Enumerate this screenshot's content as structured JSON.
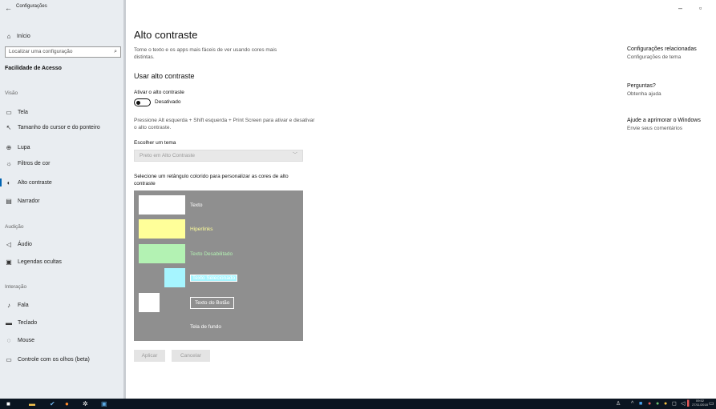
{
  "window": {
    "app_title": "Configurações",
    "back_icon": "arrow-left-icon",
    "controls": {
      "minimize": "–",
      "maximize": "▫"
    }
  },
  "sidebar": {
    "home": {
      "label": "Início",
      "icon": "home-icon"
    },
    "search_placeholder": "Localizar uma configuração",
    "section_title": "Facilidade de Acesso",
    "groups": [
      {
        "label": "Visão",
        "items": [
          {
            "label": "Tela",
            "icon": "monitor-icon"
          },
          {
            "label": "Tamanho do cursor e do ponteiro",
            "icon": "cursor-icon"
          },
          {
            "label": "Lupa",
            "icon": "magnifier-icon"
          },
          {
            "label": "Filtros de cor",
            "icon": "color-filter-icon"
          },
          {
            "label": "Alto contraste",
            "icon": "contrast-icon",
            "selected": true
          },
          {
            "label": "Narrador",
            "icon": "narrator-icon"
          }
        ]
      },
      {
        "label": "Audição",
        "items": [
          {
            "label": "Áudio",
            "icon": "speaker-icon"
          },
          {
            "label": "Legendas ocultas",
            "icon": "captions-icon"
          }
        ]
      },
      {
        "label": "Interação",
        "items": [
          {
            "label": "Fala",
            "icon": "microphone-icon"
          },
          {
            "label": "Teclado",
            "icon": "keyboard-icon"
          },
          {
            "label": "Mouse",
            "icon": "mouse-icon"
          },
          {
            "label": "Controle com os olhos (beta)",
            "icon": "eye-control-icon"
          }
        ]
      }
    ]
  },
  "main": {
    "title": "Alto contraste",
    "description": "Torne o texto e os apps mais fáceis de ver usando cores mais distintas.",
    "subheading": "Usar alto contraste",
    "toggle_label": "Ativar o alto contraste",
    "toggle_state": "Desativado",
    "toggle_on": false,
    "hint": "Pressione Alt esquerda + Shift esquerda + Print Screen para ativar e desativar o alto contraste.",
    "theme_label": "Escolher um tema",
    "theme_value": "Preto em Alto Contraste",
    "rect_hint": "Selecione um retângulo colorido para personalizar as cores de alto contraste",
    "preview": {
      "background_color": "#8f8f8f",
      "text": {
        "label": "Texto",
        "swatch": "#ffffff",
        "label_color": "#ffffff"
      },
      "hyperlinks": {
        "label": "Hiperlinks",
        "swatch": "#ffff99",
        "label_color": "#ffff99"
      },
      "disabled": {
        "label": "Texto Desabilitado",
        "swatch": "#b3f2b3",
        "label_color": "#b3f2b3"
      },
      "selected": {
        "label": "Texto Selecionado",
        "swatch": "#a6f5ff",
        "label_color": "#ffffff",
        "label_bg": "#a6f5ff"
      },
      "button": {
        "label": "Texto do Botão",
        "swatch": "#ffffff",
        "label_color": "#ffffff"
      },
      "background_label": "Tela de fundo"
    },
    "apply": "Aplicar",
    "cancel": "Cancelar"
  },
  "related": [
    {
      "heading": "Configurações relacionadas",
      "link": "Configurações de tema"
    },
    {
      "heading": "Perguntas?",
      "link": "Obtenha ajuda"
    },
    {
      "heading": "Ajude a aprimorar o Windows",
      "link": "Envie seus comentários"
    }
  ],
  "taskbar": {
    "apps": [
      "start-icon",
      "file-explorer-icon",
      "paint-icon",
      "firefox-icon",
      "settings-icon",
      "photos-icon"
    ],
    "clock_time": "09:52",
    "clock_date": "27/11/2018"
  }
}
